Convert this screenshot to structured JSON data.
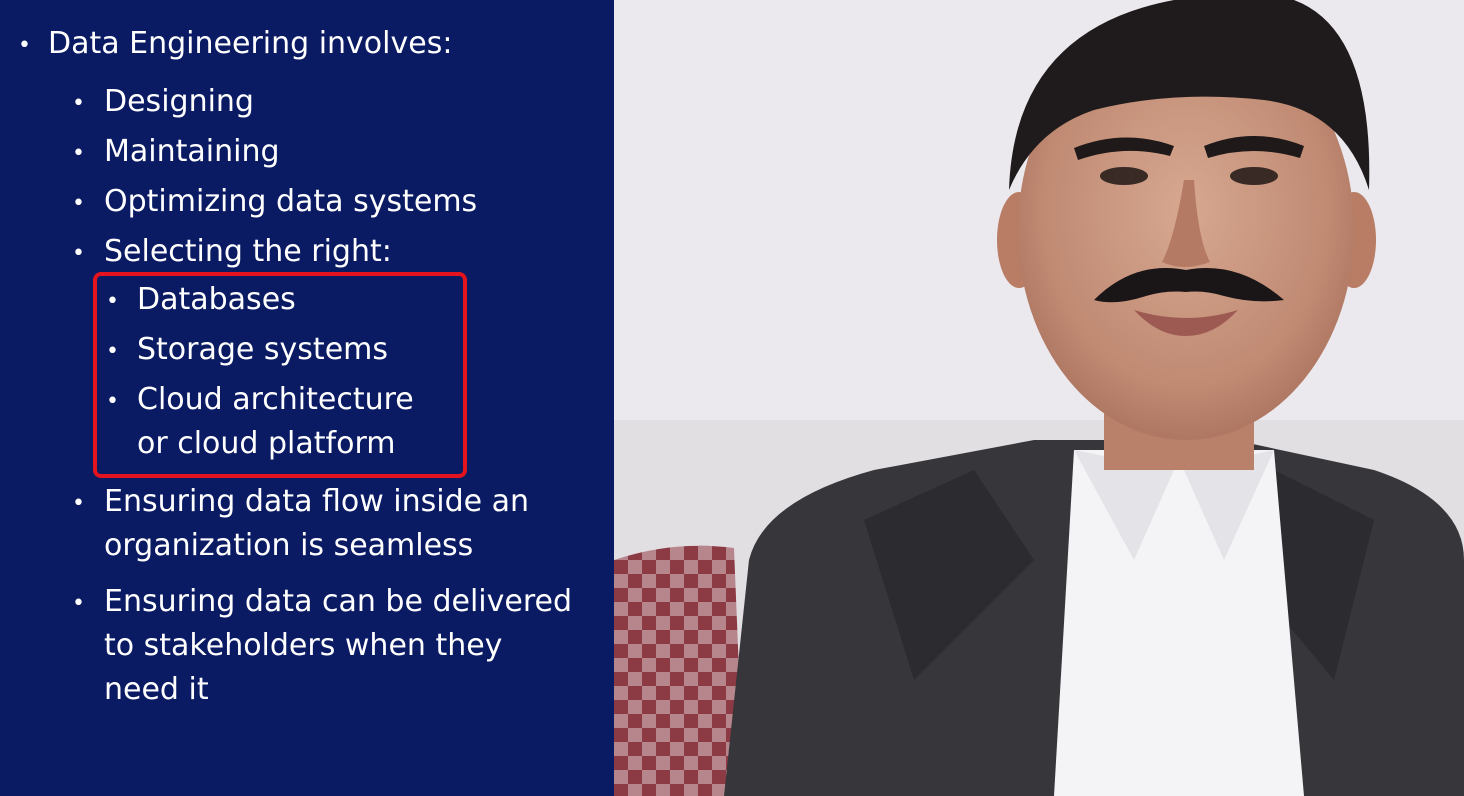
{
  "slide": {
    "heading": "Data Engineering involves:",
    "items": [
      "Designing",
      "Maintaining",
      "Optimizing data systems",
      "Selecting the right:"
    ],
    "subitems": [
      "Databases",
      "Storage systems",
      "Cloud architecture",
      "or cloud platform"
    ],
    "items_after": [
      "Ensuring data flow inside an",
      "organization is seamless",
      "Ensuring data can be delivered",
      "to stakeholders when they",
      "need it"
    ],
    "bullet_char": "•"
  },
  "colors": {
    "slide_bg": "#0a1b63",
    "text": "#ffffff",
    "highlight": "#e3141e"
  }
}
